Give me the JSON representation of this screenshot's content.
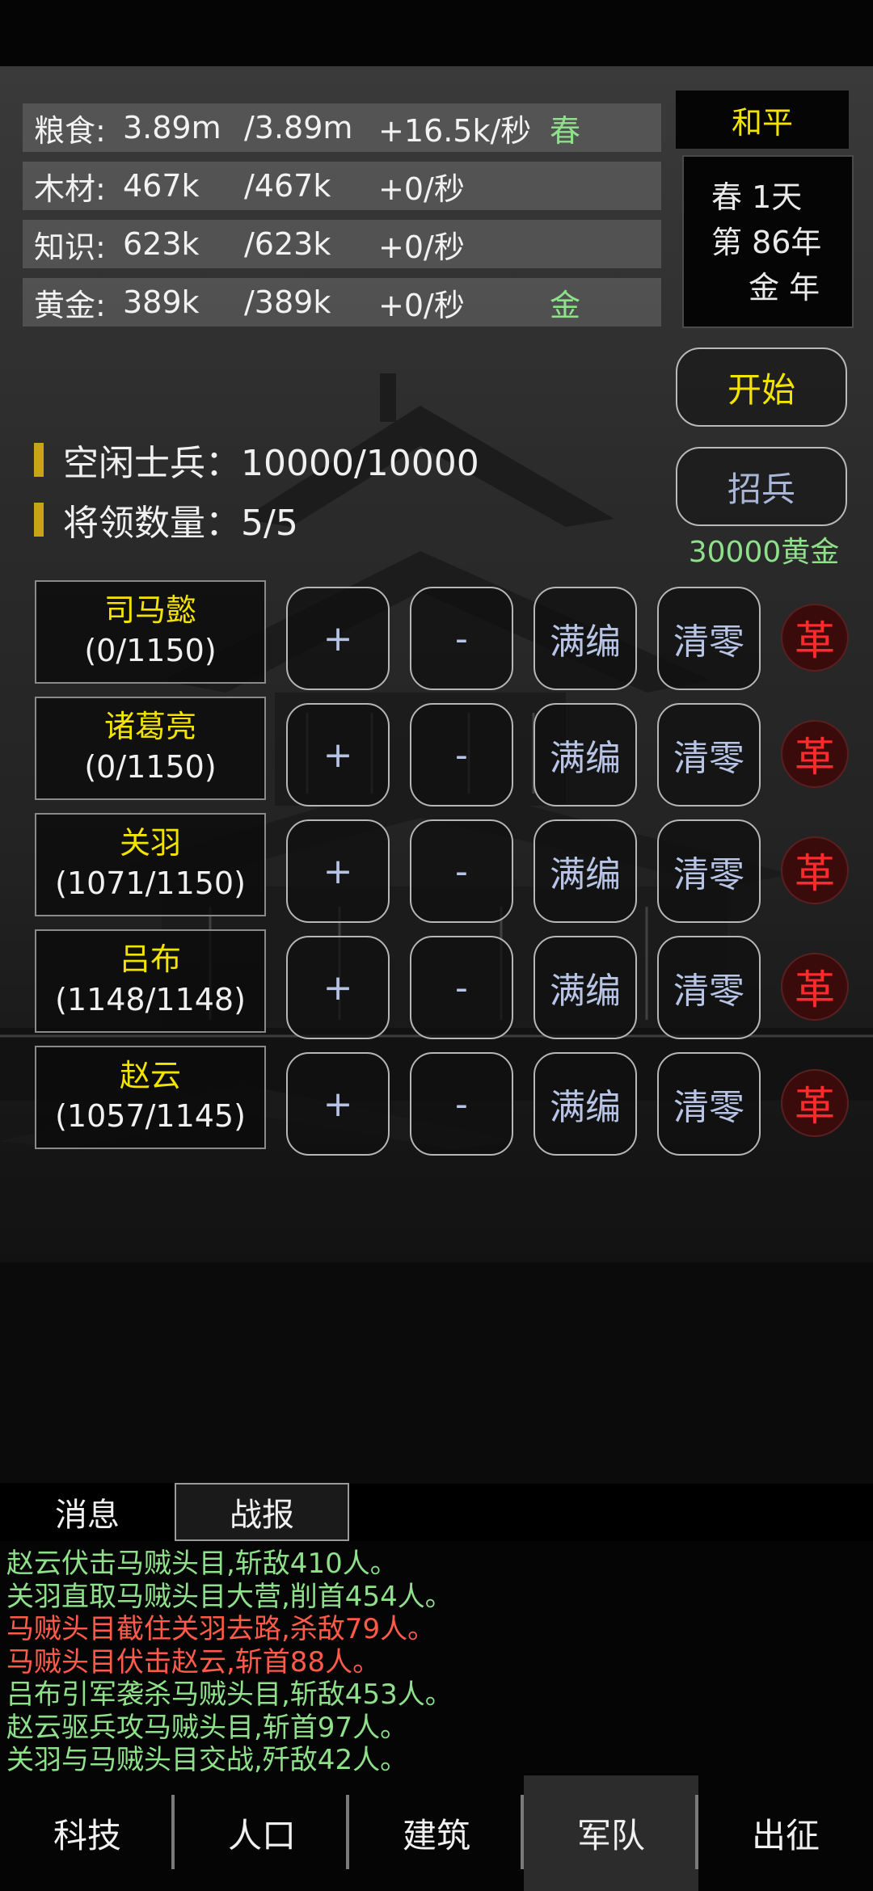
{
  "resources": [
    {
      "name": "粮食:",
      "current": "3.89m",
      "cap": "/3.89m",
      "rate": "+16.5k/秒",
      "tag": "春"
    },
    {
      "name": "木材:",
      "current": "467k",
      "cap": "/467k",
      "rate": "+0/秒",
      "tag": ""
    },
    {
      "name": "知识:",
      "current": "623k",
      "cap": "/623k",
      "rate": "+0/秒",
      "tag": ""
    },
    {
      "name": "黄金:",
      "current": "389k",
      "cap": "/389k",
      "rate": "+0/秒",
      "tag": "金"
    }
  ],
  "status": {
    "peace": "和平",
    "season_day": "春 1天",
    "year": "第 86年",
    "element_year": "金 年"
  },
  "actions": {
    "start": "开始",
    "recruit": "招兵",
    "recruit_cost": "30000黄金"
  },
  "stats": {
    "idle_soldiers": "空闲士兵：10000/10000",
    "general_count": "将领数量：5/5"
  },
  "button_labels": {
    "plus": "+",
    "minus": "-",
    "full": "满编",
    "clear": "清零",
    "dismiss": "革"
  },
  "generals": [
    {
      "name": "司马懿",
      "count": "(0/1150)"
    },
    {
      "name": "诸葛亮",
      "count": "(0/1150)"
    },
    {
      "name": "关羽",
      "count": "(1071/1150)"
    },
    {
      "name": "吕布",
      "count": "(1148/1148)"
    },
    {
      "name": "赵云",
      "count": "(1057/1145)"
    }
  ],
  "tabs": {
    "messages": "消息",
    "battle_report": "战报"
  },
  "log": [
    {
      "text": "赵云伏击马贼头目,斩敌410人。",
      "color": "#8fe08a"
    },
    {
      "text": "关羽直取马贼头目大营,削首454人。",
      "color": "#8fe08a"
    },
    {
      "text": "马贼头目截住关羽去路,杀敌79人。",
      "color": "#ff5a4a"
    },
    {
      "text": "马贼头目伏击赵云,斩首88人。",
      "color": "#ff5a4a"
    },
    {
      "text": "吕布引军袭杀马贼头目,斩敌453人。",
      "color": "#8fe08a"
    },
    {
      "text": "赵云驱兵攻马贼头目,斩首97人。",
      "color": "#8fe08a"
    },
    {
      "text": "关羽与马贼头目交战,歼敌42人。",
      "color": "#8fe08a"
    }
  ],
  "nav": [
    "科技",
    "人口",
    "建筑",
    "军队",
    "出征"
  ],
  "nav_active": "军队"
}
